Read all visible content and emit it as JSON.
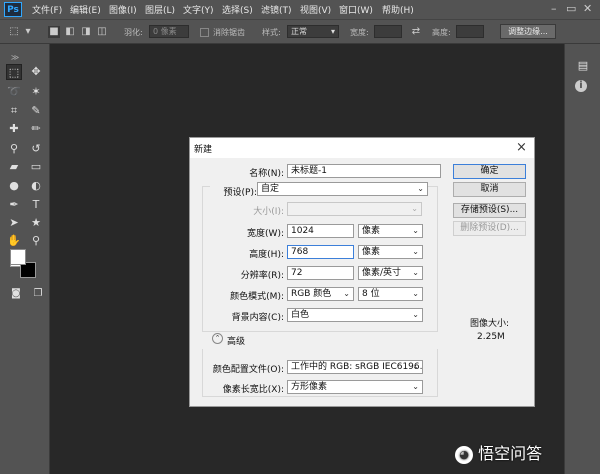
{
  "app": {
    "logo": "Ps"
  },
  "menubar": {
    "items": [
      "文件(F)",
      "编辑(E)",
      "图像(I)",
      "图层(L)",
      "文字(Y)",
      "选择(S)",
      "滤镜(T)",
      "视图(V)",
      "窗口(W)",
      "帮助(H)"
    ]
  },
  "optionsbar": {
    "feather_label": "羽化:",
    "feather_value": "0 像素",
    "antialias_label": "消除锯齿",
    "style_label": "样式:",
    "style_value": "正常",
    "width_label": "宽度:",
    "height_label": "高度:",
    "refine_button": "调整边缘..."
  },
  "toolbox": {
    "tools": [
      "marquee-icon",
      "move-icon",
      "lasso-icon",
      "magic-wand-icon",
      "crop-icon",
      "eyedropper-icon",
      "healing-brush-icon",
      "brush-icon",
      "clone-stamp-icon",
      "history-brush-icon",
      "eraser-icon",
      "gradient-icon",
      "blur-icon",
      "dodge-icon",
      "pen-icon",
      "type-icon",
      "path-select-icon",
      "shape-icon",
      "hand-icon",
      "zoom-icon"
    ],
    "foreground_color": "#ffffff",
    "background_color": "#000000"
  },
  "dialog": {
    "title": "新建",
    "name_label": "名称(N):",
    "name_value": "未标题-1",
    "preset_label": "预设(P):",
    "preset_value": "自定",
    "size_label": "大小(I):",
    "width_label": "宽度(W):",
    "width_value": "1024",
    "width_unit": "像素",
    "height_label": "高度(H):",
    "height_value": "768",
    "height_unit": "像素",
    "resolution_label": "分辨率(R):",
    "resolution_value": "72",
    "resolution_unit": "像素/英寸",
    "color_mode_label": "颜色模式(M):",
    "color_mode_value": "RGB 颜色",
    "bit_depth": "8 位",
    "background_label": "背景内容(C):",
    "background_value": "白色",
    "advanced_label": "高级",
    "color_profile_label": "颜色配置文件(O):",
    "color_profile_value": "工作中的 RGB: sRGB IEC6196...",
    "pixel_aspect_label": "像素长宽比(X):",
    "pixel_aspect_value": "方形像素",
    "ok_button": "确定",
    "cancel_button": "取消",
    "save_preset_button": "存储预设(S)...",
    "delete_preset_button": "删除预设(D)...",
    "image_size_label": "图像大小:",
    "image_size_value": "2.25M",
    "close_icon": "×"
  },
  "watermark": {
    "text": "悟空问答"
  }
}
